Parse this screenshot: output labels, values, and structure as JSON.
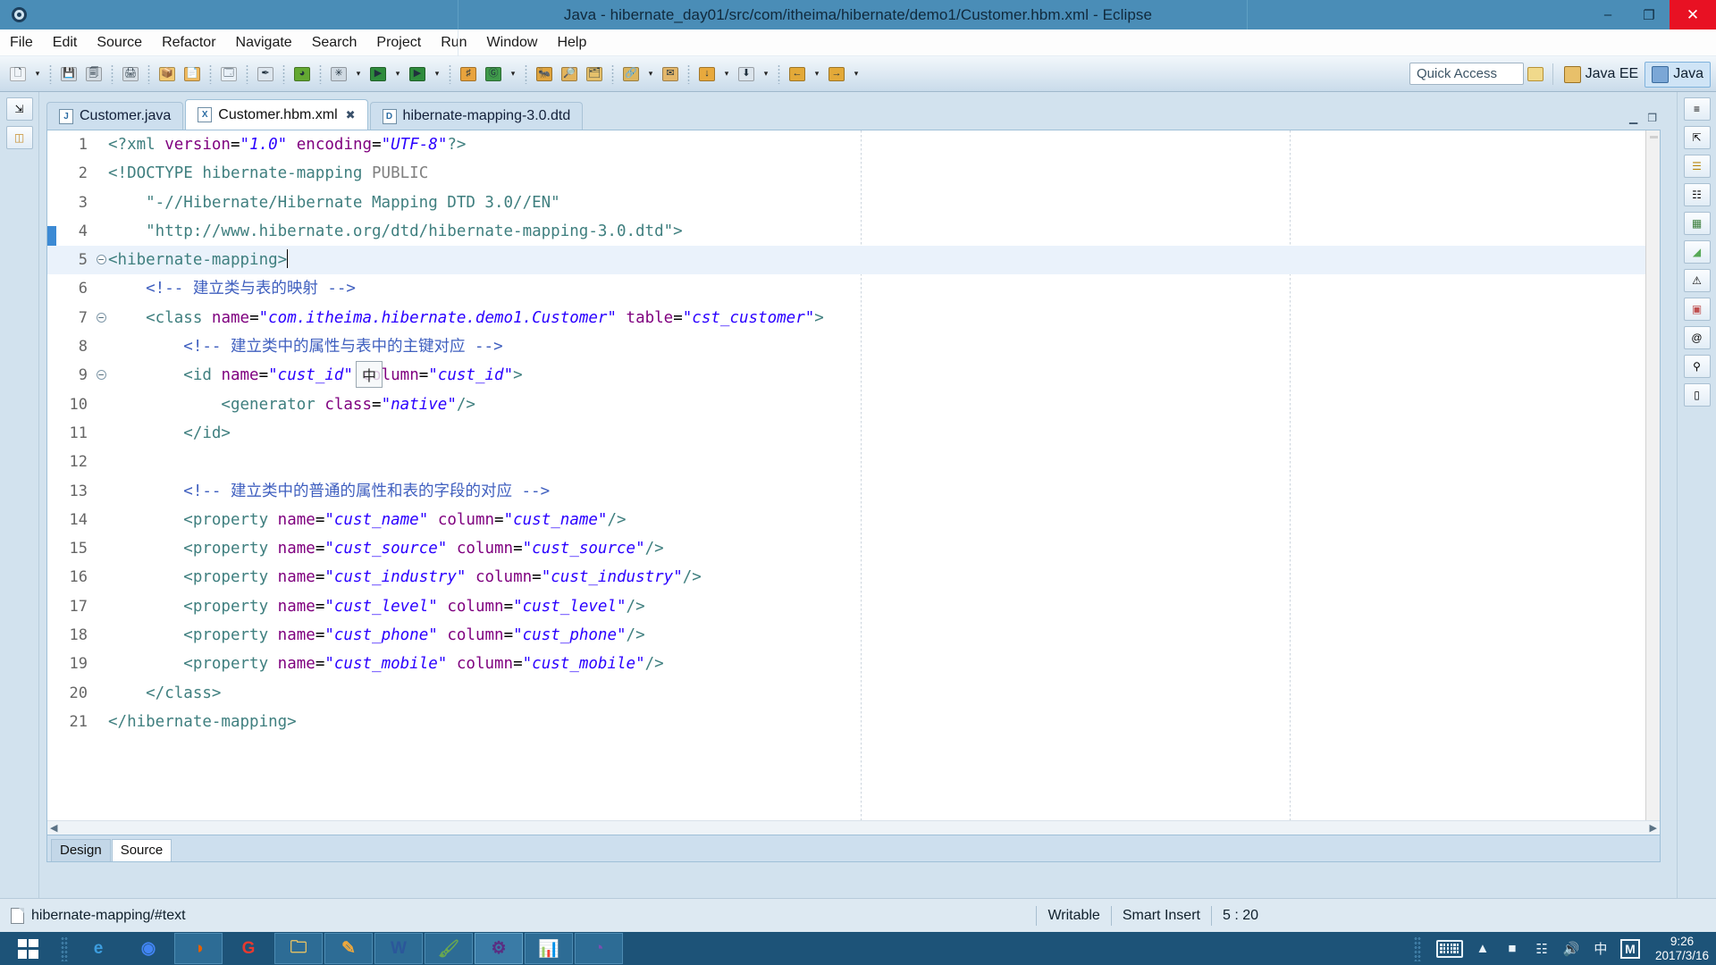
{
  "window": {
    "title": "Java - hibernate_day01/src/com/itheima/hibernate/demo1/Customer.hbm.xml - Eclipse",
    "app_icon": "eclipse-gear-icon",
    "minimize": "–",
    "maximize": "❐",
    "close": "✕"
  },
  "menubar": {
    "items": [
      {
        "label": "File"
      },
      {
        "label": "Edit"
      },
      {
        "label": "Source"
      },
      {
        "label": "Refactor"
      },
      {
        "label": "Navigate"
      },
      {
        "label": "Search"
      },
      {
        "label": "Project"
      },
      {
        "label": "Run"
      },
      {
        "label": "Window"
      },
      {
        "label": "Help"
      }
    ]
  },
  "toolbar": {
    "items": [
      {
        "name": "new-wizard-icon",
        "glyph": "🗋",
        "color": "#f0f4f8"
      },
      {
        "name": "new-wizard-dropdown-icon",
        "glyph": "▾"
      },
      {
        "name": "save-icon",
        "glyph": "💾",
        "color": "#d5dde4"
      },
      {
        "name": "save-all-icon",
        "glyph": "🗐",
        "color": "#d5dde4"
      },
      {
        "name": "print-icon",
        "glyph": "🖨",
        "color": "#d8e0e7"
      },
      {
        "name": "new-java-package-icon",
        "glyph": "📦",
        "color": "#f2c971"
      },
      {
        "name": "new-java-class-icon",
        "glyph": "📄",
        "color": "#f0ba5e"
      },
      {
        "name": "open-type-icon",
        "glyph": "🗔",
        "color": "#e9f1f8"
      },
      {
        "name": "toggle-mark-occurrences-icon",
        "glyph": "✒",
        "color": "#dde6ee"
      },
      {
        "name": "skip-breakpoints-icon",
        "glyph": "◕",
        "color": "#63a832"
      },
      {
        "name": "debug-icon",
        "glyph": "✳",
        "color": "#cfd9e2"
      },
      {
        "name": "debug-dropdown-icon",
        "glyph": "▾"
      },
      {
        "name": "run-icon",
        "glyph": "▶",
        "color": "#2e8b3c"
      },
      {
        "name": "run-dropdown-icon",
        "glyph": "▾"
      },
      {
        "name": "run-external-tools-icon",
        "glyph": "▶",
        "color": "#2e8b3c"
      },
      {
        "name": "external-tools-dropdown-icon",
        "glyph": "▾"
      },
      {
        "name": "new-tag-icon",
        "glyph": "♯",
        "color": "#e8a33d"
      },
      {
        "name": "coverage-icon",
        "glyph": "Ⓖ",
        "color": "#3f9a4a"
      },
      {
        "name": "coverage-dropdown-icon",
        "glyph": "▾"
      },
      {
        "name": "new-ant-build-icon",
        "glyph": "🐜",
        "color": "#e0a53f"
      },
      {
        "name": "search-icon",
        "glyph": "🔎",
        "color": "#e2b45c"
      },
      {
        "name": "open-task-icon",
        "glyph": "🗂",
        "color": "#e5c06b"
      },
      {
        "name": "link-editor-icon",
        "glyph": "🔗",
        "color": "#dcb55e"
      },
      {
        "name": "link-dropdown-icon",
        "glyph": "▾"
      },
      {
        "name": "annotation-icon",
        "glyph": "✉",
        "color": "#e3b76a"
      },
      {
        "name": "previous-annotation-icon",
        "glyph": "↓",
        "color": "#e8a93d"
      },
      {
        "name": "previous-dropdown-icon",
        "glyph": "▾"
      },
      {
        "name": "next-annotation-icon",
        "glyph": "⬇",
        "color": "#dbe4ec"
      },
      {
        "name": "next-dropdown-icon",
        "glyph": "▾"
      },
      {
        "name": "back-icon",
        "glyph": "←",
        "color": "#e3a938"
      },
      {
        "name": "back-dropdown-icon",
        "glyph": "▾"
      },
      {
        "name": "forward-icon",
        "glyph": "→",
        "color": "#e3a938"
      },
      {
        "name": "forward-dropdown-icon",
        "glyph": "▾"
      }
    ],
    "quick_access_placeholder": "Quick Access"
  },
  "perspectives": {
    "open_perspective_tooltip": "Open Perspective",
    "items": [
      {
        "label": "Java EE",
        "active": false
      },
      {
        "label": "Java",
        "active": true
      }
    ]
  },
  "editor": {
    "tabs": [
      {
        "label": "Customer.java",
        "icon_letter": "J",
        "active": false,
        "closable": false
      },
      {
        "label": "Customer.hbm.xml",
        "icon_letter": "X",
        "active": true,
        "closable": true
      },
      {
        "label": "hibernate-mapping-3.0.dtd",
        "icon_letter": "D",
        "active": false,
        "closable": false
      }
    ],
    "close_glyph": "✖",
    "minimize_glyph": "▁",
    "maximize_glyph": "❐",
    "bottom_tabs": [
      {
        "label": "Design",
        "active": false
      },
      {
        "label": "Source",
        "active": true
      }
    ],
    "ime_indicator": "中",
    "lines": [
      {
        "n": "1",
        "fold": "",
        "current": false,
        "parts": [
          {
            "t": "<?xml ",
            "c": "s-tag"
          },
          {
            "t": "version",
            "c": "s-attr"
          },
          {
            "t": "=",
            "c": "s-punct"
          },
          {
            "t": "\"1.0\"",
            "c": "s-val"
          },
          {
            "t": " ",
            "c": "s-plain"
          },
          {
            "t": "encoding",
            "c": "s-attr"
          },
          {
            "t": "=",
            "c": "s-punct"
          },
          {
            "t": "\"UTF-8\"",
            "c": "s-val"
          },
          {
            "t": "?>",
            "c": "s-tag"
          }
        ]
      },
      {
        "n": "2",
        "fold": "",
        "current": false,
        "parts": [
          {
            "t": "<!DOCTYPE ",
            "c": "s-doctype"
          },
          {
            "t": "hibernate-mapping",
            "c": "s-doctype"
          },
          {
            "t": " PUBLIC",
            "c": "s-gray"
          }
        ]
      },
      {
        "n": "3",
        "fold": "",
        "current": false,
        "parts": [
          {
            "t": "    \"-//Hibernate/Hibernate Mapping DTD 3.0//EN\"",
            "c": "s-doctype"
          }
        ]
      },
      {
        "n": "4",
        "fold": "",
        "current": false,
        "parts": [
          {
            "t": "    \"http://www.hibernate.org/dtd/hibernate-mapping-3.0.dtd\">",
            "c": "s-doctype"
          }
        ]
      },
      {
        "n": "5",
        "fold": "-",
        "current": true,
        "caret": true,
        "parts": [
          {
            "t": "<hibernate-mapping>",
            "c": "s-tag"
          }
        ]
      },
      {
        "n": "6",
        "fold": "",
        "current": false,
        "parts": [
          {
            "t": "    <!-- 建立类与表的映射 -->",
            "c": "s-cmt"
          }
        ]
      },
      {
        "n": "7",
        "fold": "-",
        "current": false,
        "parts": [
          {
            "t": "    <class ",
            "c": "s-tag"
          },
          {
            "t": "name",
            "c": "s-attr"
          },
          {
            "t": "=",
            "c": "s-punct"
          },
          {
            "t": "\"com.itheima.hibernate.demo1.Customer\"",
            "c": "s-val"
          },
          {
            "t": " ",
            "c": "s-plain"
          },
          {
            "t": "table",
            "c": "s-attr"
          },
          {
            "t": "=",
            "c": "s-punct"
          },
          {
            "t": "\"cst_customer\"",
            "c": "s-val"
          },
          {
            "t": ">",
            "c": "s-tag"
          }
        ]
      },
      {
        "n": "8",
        "fold": "",
        "current": false,
        "parts": [
          {
            "t": "        <!-- 建立类中的属性与表中的主键对应 -->",
            "c": "s-cmt"
          }
        ]
      },
      {
        "n": "9",
        "fold": "-",
        "current": false,
        "parts": [
          {
            "t": "        <id ",
            "c": "s-tag"
          },
          {
            "t": "name",
            "c": "s-attr"
          },
          {
            "t": "=",
            "c": "s-punct"
          },
          {
            "t": "\"cust_id\"",
            "c": "s-val"
          },
          {
            "t": " ",
            "c": "s-plain"
          },
          {
            "t": "column",
            "c": "s-attr"
          },
          {
            "t": "=",
            "c": "s-punct"
          },
          {
            "t": "\"cust_id\"",
            "c": "s-val"
          },
          {
            "t": ">",
            "c": "s-tag"
          }
        ]
      },
      {
        "n": "10",
        "fold": "",
        "current": false,
        "parts": [
          {
            "t": "            <generator ",
            "c": "s-tag"
          },
          {
            "t": "class",
            "c": "s-attr"
          },
          {
            "t": "=",
            "c": "s-punct"
          },
          {
            "t": "\"native\"",
            "c": "s-val"
          },
          {
            "t": "/>",
            "c": "s-tag"
          }
        ]
      },
      {
        "n": "11",
        "fold": "",
        "current": false,
        "parts": [
          {
            "t": "        </id>",
            "c": "s-tag"
          }
        ]
      },
      {
        "n": "12",
        "fold": "",
        "current": false,
        "parts": [
          {
            "t": "",
            "c": "s-plain"
          }
        ]
      },
      {
        "n": "13",
        "fold": "",
        "current": false,
        "parts": [
          {
            "t": "        <!-- 建立类中的普通的属性和表的字段的对应 -->",
            "c": "s-cmt"
          }
        ]
      },
      {
        "n": "14",
        "fold": "",
        "current": false,
        "parts": [
          {
            "t": "        <property ",
            "c": "s-tag"
          },
          {
            "t": "name",
            "c": "s-attr"
          },
          {
            "t": "=",
            "c": "s-punct"
          },
          {
            "t": "\"cust_name\"",
            "c": "s-val"
          },
          {
            "t": " ",
            "c": "s-plain"
          },
          {
            "t": "column",
            "c": "s-attr"
          },
          {
            "t": "=",
            "c": "s-punct"
          },
          {
            "t": "\"cust_name\"",
            "c": "s-val"
          },
          {
            "t": "/>",
            "c": "s-tag"
          }
        ]
      },
      {
        "n": "15",
        "fold": "",
        "current": false,
        "parts": [
          {
            "t": "        <property ",
            "c": "s-tag"
          },
          {
            "t": "name",
            "c": "s-attr"
          },
          {
            "t": "=",
            "c": "s-punct"
          },
          {
            "t": "\"cust_source\"",
            "c": "s-val"
          },
          {
            "t": " ",
            "c": "s-plain"
          },
          {
            "t": "column",
            "c": "s-attr"
          },
          {
            "t": "=",
            "c": "s-punct"
          },
          {
            "t": "\"cust_source\"",
            "c": "s-val"
          },
          {
            "t": "/>",
            "c": "s-tag"
          }
        ]
      },
      {
        "n": "16",
        "fold": "",
        "current": false,
        "parts": [
          {
            "t": "        <property ",
            "c": "s-tag"
          },
          {
            "t": "name",
            "c": "s-attr"
          },
          {
            "t": "=",
            "c": "s-punct"
          },
          {
            "t": "\"cust_industry\"",
            "c": "s-val"
          },
          {
            "t": " ",
            "c": "s-plain"
          },
          {
            "t": "column",
            "c": "s-attr"
          },
          {
            "t": "=",
            "c": "s-punct"
          },
          {
            "t": "\"cust_industry\"",
            "c": "s-val"
          },
          {
            "t": "/>",
            "c": "s-tag"
          }
        ]
      },
      {
        "n": "17",
        "fold": "",
        "current": false,
        "parts": [
          {
            "t": "        <property ",
            "c": "s-tag"
          },
          {
            "t": "name",
            "c": "s-attr"
          },
          {
            "t": "=",
            "c": "s-punct"
          },
          {
            "t": "\"cust_level\"",
            "c": "s-val"
          },
          {
            "t": " ",
            "c": "s-plain"
          },
          {
            "t": "column",
            "c": "s-attr"
          },
          {
            "t": "=",
            "c": "s-punct"
          },
          {
            "t": "\"cust_level\"",
            "c": "s-val"
          },
          {
            "t": "/>",
            "c": "s-tag"
          }
        ]
      },
      {
        "n": "18",
        "fold": "",
        "current": false,
        "parts": [
          {
            "t": "        <property ",
            "c": "s-tag"
          },
          {
            "t": "name",
            "c": "s-attr"
          },
          {
            "t": "=",
            "c": "s-punct"
          },
          {
            "t": "\"cust_phone\"",
            "c": "s-val"
          },
          {
            "t": " ",
            "c": "s-plain"
          },
          {
            "t": "column",
            "c": "s-attr"
          },
          {
            "t": "=",
            "c": "s-punct"
          },
          {
            "t": "\"cust_phone\"",
            "c": "s-val"
          },
          {
            "t": "/>",
            "c": "s-tag"
          }
        ]
      },
      {
        "n": "19",
        "fold": "",
        "current": false,
        "parts": [
          {
            "t": "        <property ",
            "c": "s-tag"
          },
          {
            "t": "name",
            "c": "s-attr"
          },
          {
            "t": "=",
            "c": "s-punct"
          },
          {
            "t": "\"cust_mobile\"",
            "c": "s-val"
          },
          {
            "t": " ",
            "c": "s-plain"
          },
          {
            "t": "column",
            "c": "s-attr"
          },
          {
            "t": "=",
            "c": "s-punct"
          },
          {
            "t": "\"cust_mobile\"",
            "c": "s-val"
          },
          {
            "t": "/>",
            "c": "s-tag"
          }
        ]
      },
      {
        "n": "20",
        "fold": "",
        "current": false,
        "parts": [
          {
            "t": "    </class>",
            "c": "s-tag"
          }
        ]
      },
      {
        "n": "21",
        "fold": "",
        "current": false,
        "parts": [
          {
            "t": "</hibernate-mapping>",
            "c": "s-tag"
          }
        ]
      }
    ]
  },
  "statusbar": {
    "selection_path": "hibernate-mapping/#text",
    "writable": "Writable",
    "insert_mode": "Smart Insert",
    "cursor_position": "5 : 20"
  },
  "taskbar": {
    "start_label": "Start",
    "apps": [
      {
        "name": "internet-explorer-icon",
        "glyph": "e",
        "color": "#3d9ee0",
        "open": false
      },
      {
        "name": "google-chrome-icon",
        "glyph": "◉",
        "color": "#4285f4",
        "open": false
      },
      {
        "name": "firefox-icon",
        "glyph": "◑",
        "color": "#e66000",
        "open": true
      },
      {
        "name": "sogou-browser-icon",
        "glyph": "G",
        "color": "#e8392f",
        "open": false
      },
      {
        "name": "file-explorer-icon",
        "glyph": "🗀",
        "color": "#f4c860",
        "open": true
      },
      {
        "name": "editplus-icon",
        "glyph": "✎",
        "color": "#f0a93c",
        "open": true
      },
      {
        "name": "microsoft-word-icon",
        "glyph": "W",
        "color": "#2b579a",
        "open": true
      },
      {
        "name": "paint-brushes-icon",
        "glyph": "🖌",
        "color": "#6aa84f",
        "open": true
      },
      {
        "name": "eclipse-javaee-icon",
        "glyph": "⚙",
        "color": "#5b2d82",
        "open": true,
        "active": true
      },
      {
        "name": "analysis-tool-icon",
        "glyph": "📊",
        "color": "#4a90d9",
        "open": true
      },
      {
        "name": "media-player-icon",
        "glyph": "◔",
        "color": "#7b4fb0",
        "open": true
      }
    ],
    "tray": {
      "show_hidden_glyph": "▲",
      "keyboard_icon": "onscreen-keyboard-icon",
      "battery_icon": "battery-icon",
      "network_icon": "network-icon",
      "volume_icon": "volume-muted-icon",
      "ime_label": "中",
      "ime_mode_label": "M",
      "time": "9:26",
      "date": "2017/3/16"
    }
  }
}
